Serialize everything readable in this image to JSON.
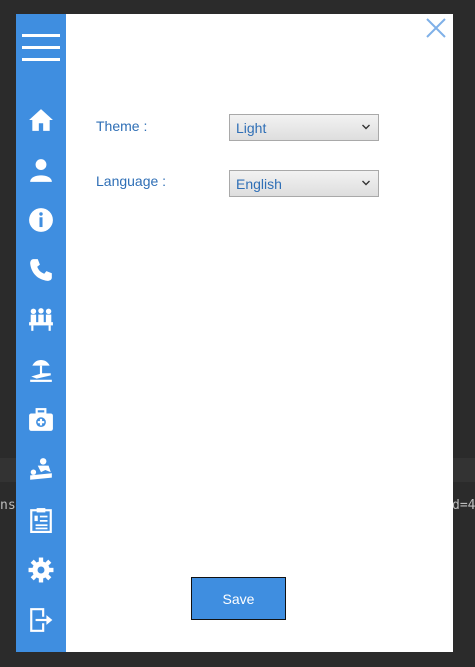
{
  "background": {
    "left_text": "ns",
    "right_text": "d=4"
  },
  "sidebar": {
    "items": [
      {
        "icon": "home-icon"
      },
      {
        "icon": "user-icon"
      },
      {
        "icon": "info-icon"
      },
      {
        "icon": "phone-icon"
      },
      {
        "icon": "meeting-icon"
      },
      {
        "icon": "beach-icon"
      },
      {
        "icon": "medical-kit-icon"
      },
      {
        "icon": "massage-icon"
      },
      {
        "icon": "clipboard-icon"
      },
      {
        "icon": "gear-icon"
      },
      {
        "icon": "logout-icon"
      }
    ]
  },
  "settings": {
    "theme_label": "Theme :",
    "theme_value": "Light",
    "language_label": "Language :",
    "language_value": "English"
  },
  "actions": {
    "save_label": "Save"
  },
  "colors": {
    "accent": "#3f8ee0",
    "label_text": "#2f6fb6"
  }
}
